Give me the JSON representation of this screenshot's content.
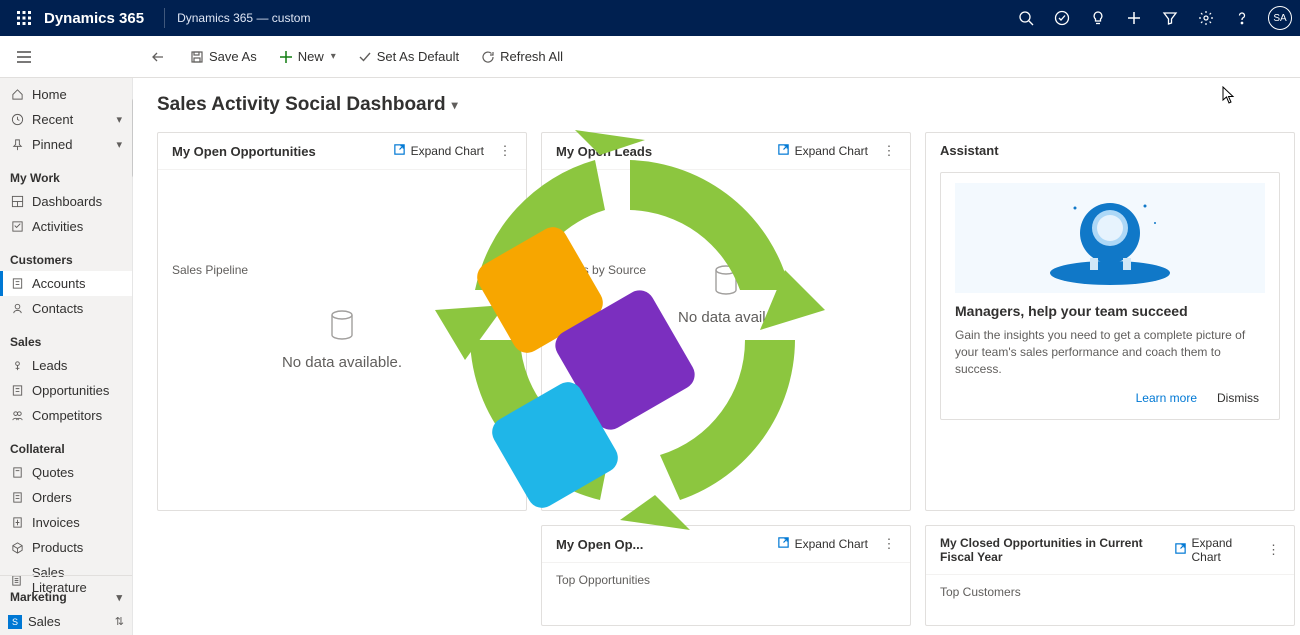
{
  "topbar": {
    "brand": "Dynamics 365",
    "subtitle": "Dynamics 365 — custom",
    "avatar": "SA"
  },
  "cmdbar": {
    "saveas": "Save As",
    "new": "New",
    "setdefault": "Set As Default",
    "refresh": "Refresh All"
  },
  "sidebar": {
    "home": "Home",
    "recent": "Recent",
    "pinned": "Pinned",
    "sec_mywork": "My Work",
    "dashboards": "Dashboards",
    "activities": "Activities",
    "sec_customers": "Customers",
    "accounts": "Accounts",
    "contacts": "Contacts",
    "sec_sales": "Sales",
    "leads": "Leads",
    "opportunities": "Opportunities",
    "competitors": "Competitors",
    "sec_collateral": "Collateral",
    "quotes": "Quotes",
    "orders": "Orders",
    "invoices": "Invoices",
    "products": "Products",
    "saleslit": "Sales Literature",
    "sec_marketing": "Marketing",
    "app": "Sales"
  },
  "dash": {
    "title": "Sales Activity Social Dashboard",
    "expand": "Expand Chart",
    "nodata": "No data available.",
    "nodata2": "No data availa",
    "c1": {
      "title": "My Open Opportunities",
      "sub": "Sales Pipeline"
    },
    "c2": {
      "title": "My Open Leads",
      "sub": "Leads by Source"
    },
    "c3": {
      "title": "Assistant",
      "heading": "Managers, help your team succeed",
      "body": "Gain the insights you need to get a complete picture of your team's sales performance and coach them to success.",
      "learnmore": "Learn more",
      "dismiss": "Dismiss"
    },
    "c4": {
      "title": "My Open Op...",
      "sub": "Top Opportunities"
    },
    "c5": {
      "title": "My Closed Opportunities in Current Fiscal Year",
      "sub": "Top Customers"
    }
  }
}
